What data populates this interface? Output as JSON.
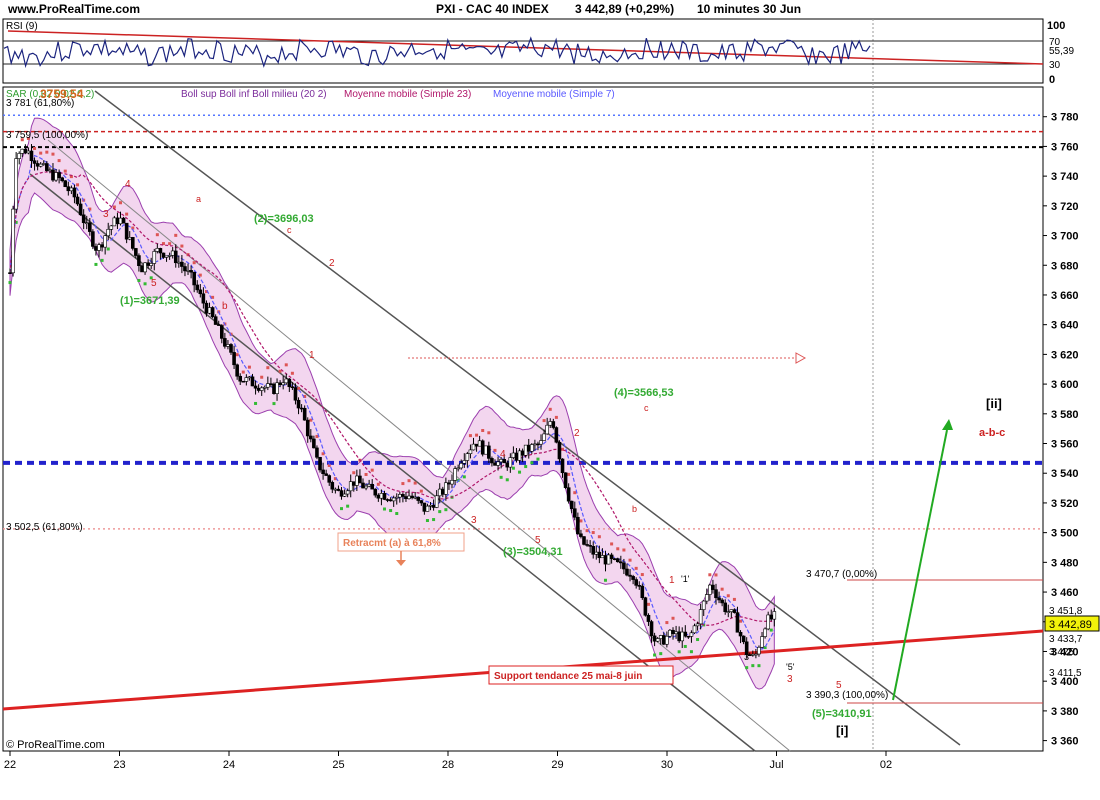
{
  "header": {
    "site": "www.ProRealTime.com",
    "instrument": "PXI - CAC 40 INDEX",
    "price": "3 442,89 (+0,29%)",
    "period": "10 minutes  30 Jun"
  },
  "footer": {
    "watermark": "© ProRealTime.com"
  },
  "rsi_panel": {
    "label": "RSI (9)",
    "scale": [
      "100",
      "70",
      "55,39",
      "30",
      "0"
    ],
    "color": "#1a237e",
    "trend_color": "#cc2222"
  },
  "legend": {
    "items": [
      {
        "text": "SAR (0,02 0,02 0,2)",
        "color": "#2e9e2e"
      },
      {
        "text": "Boll sup Boll inf Boll milieu (20 2)",
        "color": "#7a2b9a"
      },
      {
        "text": "Moyenne mobile (Simple 23)",
        "color": "#b0176a"
      },
      {
        "text": "Moyenne mobile (Simple 7)",
        "color": "#5a5aff"
      }
    ],
    "overlay_price": "3759,54"
  },
  "colors": {
    "up_candle": "#ffffff",
    "down_candle": "#000000",
    "channel": "#555555",
    "support": "#dd2222",
    "blue_level": "#2222cc",
    "sar_green": "#33bb33",
    "sar_red": "#dd5555",
    "boll_fill": "#f3d6ef",
    "arrow_green": "#22aa22"
  },
  "annotations": {
    "fib_top": "3 781 (61,80%)",
    "fib_3759": "3 759,5 (100,00%)",
    "fib_3502": "3 502,5 (61,80%)",
    "fib_3470": "3 470,7 (0,00%)",
    "fib_3390": "3 390,3 (100,00%)",
    "w1": "(1)=3671,39",
    "w2": "(2)=3696,03",
    "w3": "(3)=3504,31",
    "w4": "(4)=3566,53",
    "w5": "(5)=3410,91",
    "retracement": "Retracmt (a) à 61,8%",
    "support": "Support tendance 25 mai-8 juin",
    "ii_label": "[ii]",
    "abc": "a-b-c",
    "i_label": "[i]"
  },
  "small_labels": [
    "3",
    "4",
    "5",
    "b",
    "a",
    "c",
    "2",
    "1",
    "3",
    "4",
    "5",
    "2",
    "1",
    "c",
    "b",
    "'1'",
    "3",
    "'5'",
    "3",
    "5"
  ],
  "price_tags": [
    "3 451,8",
    "3 442,89",
    "3 433,7",
    "3 425",
    "3 411,5"
  ],
  "chart_data": {
    "type": "candlestick",
    "title": "PXI - CAC 40 INDEX",
    "interval": "10 minutes",
    "x_ticks": [
      "22",
      "23",
      "24",
      "25",
      "28",
      "29",
      "30",
      "Jul",
      "02"
    ],
    "y_ticks": [
      3780,
      3760,
      3740,
      3720,
      3700,
      3680,
      3660,
      3640,
      3620,
      3600,
      3580,
      3560,
      3540,
      3520,
      3500,
      3480,
      3460,
      3440,
      3420,
      3400,
      3380,
      3360
    ],
    "y_tick_labels": [
      "3 780",
      "3 760",
      "3 740",
      "3 720",
      "3 700",
      "3 680",
      "3 660",
      "3 640",
      "3 620",
      "3 600",
      "3 580",
      "3 560",
      "3 540",
      "3 520",
      "3 500",
      "3 480",
      "3 460",
      "3 440",
      "3 420",
      "3 400",
      "3 380",
      "3 360"
    ],
    "ylim": [
      3353,
      3800
    ],
    "last_price": 3442.89,
    "horizontal_levels": [
      {
        "price": 3781,
        "style": "dotted",
        "color": "#5577ff"
      },
      {
        "price": 3770,
        "style": "dashed",
        "color": "#cc2222"
      },
      {
        "price": 3759.5,
        "style": "dashed",
        "color": "#000000"
      },
      {
        "price": 3547,
        "style": "dashed-bold",
        "color": "#2222cc"
      },
      {
        "price": 3502.5,
        "style": "dotted",
        "color": "#ee9999"
      },
      {
        "price": 3470.7,
        "style": "solid",
        "color": "#cc4444"
      },
      {
        "price": 3390.3,
        "style": "solid",
        "color": "#cc4444"
      }
    ],
    "price_path": [
      [
        0.0,
        3675
      ],
      [
        0.05,
        3755
      ],
      [
        0.15,
        3758
      ],
      [
        0.3,
        3745
      ],
      [
        0.45,
        3738
      ],
      [
        0.6,
        3725
      ],
      [
        0.7,
        3705
      ],
      [
        0.8,
        3690
      ],
      [
        0.9,
        3705
      ],
      [
        1.0,
        3712
      ],
      [
        1.1,
        3695
      ],
      [
        1.2,
        3678
      ],
      [
        1.35,
        3690
      ],
      [
        1.5,
        3686
      ],
      [
        1.65,
        3672
      ],
      [
        1.75,
        3657
      ],
      [
        1.85,
        3644
      ],
      [
        2.0,
        3622
      ],
      [
        2.1,
        3604
      ],
      [
        2.25,
        3600
      ],
      [
        2.4,
        3596
      ],
      [
        2.5,
        3604
      ],
      [
        2.65,
        3585
      ],
      [
        2.8,
        3548
      ],
      [
        2.95,
        3530
      ],
      [
        3.0,
        3527
      ],
      [
        3.15,
        3535
      ],
      [
        3.3,
        3528
      ],
      [
        3.5,
        3524
      ],
      [
        3.65,
        3525
      ],
      [
        3.8,
        3515
      ],
      [
        4.0,
        3532
      ],
      [
        4.1,
        3548
      ],
      [
        4.25,
        3562
      ],
      [
        4.4,
        3550
      ],
      [
        4.5,
        3545
      ],
      [
        4.7,
        3555
      ],
      [
        4.85,
        3560
      ],
      [
        4.95,
        3578
      ],
      [
        5.05,
        3540
      ],
      [
        5.2,
        3495
      ],
      [
        5.35,
        3485
      ],
      [
        5.5,
        3480
      ],
      [
        5.7,
        3472
      ],
      [
        5.8,
        3448
      ],
      [
        5.9,
        3425
      ],
      [
        6.05,
        3432
      ],
      [
        6.2,
        3428
      ],
      [
        6.3,
        3445
      ],
      [
        6.4,
        3466
      ],
      [
        6.5,
        3452
      ],
      [
        6.62,
        3442
      ],
      [
        6.72,
        3420
      ],
      [
        6.8,
        3415
      ],
      [
        6.9,
        3440
      ],
      [
        6.98,
        3443
      ]
    ],
    "bollinger": {
      "upper_offset": 28,
      "lower_offset": 28
    },
    "forecast": {
      "from": [
        7.35,
        3405
      ],
      "to": [
        7.7,
        3577
      ],
      "label": "[ii]"
    }
  }
}
